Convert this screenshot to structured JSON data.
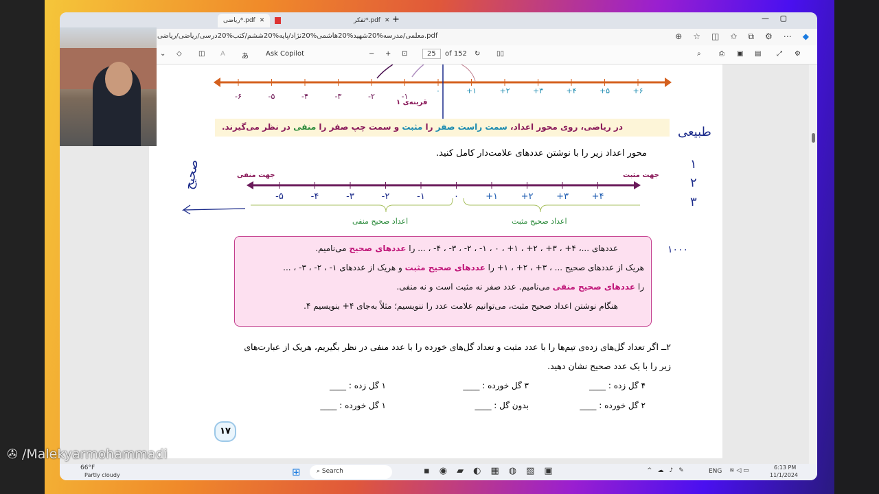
{
  "browser": {
    "tabs": [
      {
        "label": "ریاضی*.pdf"
      },
      {
        "label": "تفکر*.pdf"
      }
    ],
    "new_tab": "+",
    "url": "معلمی/مدرسه%20شهید%20هاشمی%20نژاد/پایه%20ششم/کتب%20درسی/ریاضی/ریاضی.pdf",
    "toolbar": {
      "ask_copilot": "Ask Copilot",
      "page_current": "25",
      "page_total": "of 152",
      "zoom_out": "−",
      "zoom_in": "+"
    }
  },
  "page": {
    "top_line": {
      "labels": [
        "-۶",
        "-۵",
        "-۴",
        "-۳",
        "-۲",
        "-۱",
        "۰",
        "+۱",
        "+۲",
        "+۳",
        "+۴",
        "+۵",
        "+۶"
      ],
      "caption": "قرینه‌ی ۱"
    },
    "yellow_note": {
      "p1": "در ریاضی، روی محور اعداد، ",
      "p2": "سمت راست صفر",
      "p3": " را ",
      "p4": "مثبت",
      "p5": " و سمت چپ صفر را ",
      "p6": "منفی",
      "p7": " در نظر می‌گیرند."
    },
    "instruction": "محور اعداد زیر را با نوشتن عددهای علامت‌دار کامل کنید.",
    "axis": {
      "neg_dir": "جهت منفی",
      "pos_dir": "جهت مثبت",
      "labels": [
        "-۵",
        "-۴",
        "-۳",
        "-۲",
        "-۱",
        "۰",
        "+۱",
        "+۲",
        "+۳",
        "+۴"
      ],
      "neg_group": "اعداد صحیح منفی",
      "pos_group": "اعداد صحیح مثبت"
    },
    "box": {
      "l1a": "عددهای ...، ۴+ ، ۳+ ، ۲+ ، ۱+ ، ۰ ، ۱- ، ۲- ، ۳- ، ۴- ، ... را ",
      "l1b": "عددهای صحیح",
      "l1c": " می‌نامیم.",
      "l2a": "هریک از عددهای صحیح ... ، ۳+ ، ۲+ ، ۱+ را ",
      "l2b": "عددهای صحیح مثبت",
      "l2c": " و هریک از عددهای ۱- ، ۲- ، ۳- ، ...",
      "l3a": "را ",
      "l3b": "عددهای صحیح منفی",
      "l3c": " می‌نامیم. عدد صفر نه مثبت است و نه منفی.",
      "l4": "هنگام نوشتن اعداد صحیح مثبت، می‌توانیم علامت عدد را ننویسیم؛ مثلاً به‌جای ۴+ بنویسیم ۴."
    },
    "q2": {
      "l1": "۲ــ اگر تعداد گل‌های زده‌ی تیم‌ها را با عدد مثبت و تعداد گل‌های خورده را با عدد منفی در نظر بگیریم، هریک از عبارت‌های",
      "l2": "زیر را با یک عدد صحیح نشان دهید.",
      "items": [
        "۴ گل زده : ____",
        "۳ گل خورده : ____",
        "۱ گل زده : ____",
        "۲ گل خورده : ____",
        "بدون گل : ____",
        "۱ گل خورده : ____"
      ]
    },
    "page_number": "۱۷",
    "handwriting": {
      "h1": "طبیعی",
      "h2": "۱",
      "h3": "۲",
      "h4": "۳",
      "h5": "صحیح",
      "h6": "۱۰۰۰"
    }
  },
  "taskbar": {
    "weather_temp": "66°F",
    "weather_desc": "Partly cloudy",
    "search": "Search",
    "lang": "ENG",
    "time": "6:13 PM",
    "date": "11/1/2024"
  },
  "watermark": "/Malekyarmohammadi"
}
